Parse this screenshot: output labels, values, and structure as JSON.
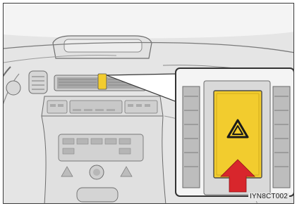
{
  "illustration": {
    "code": "IYN8CT002",
    "icons": {
      "hazard_switch": "hazard-warning-triangle-icon",
      "press_indicator": "red-arrow-up-icon"
    },
    "colors": {
      "background": "#e7e7e7",
      "line_art": "#6e6e6e",
      "switch_face": "#f2cc2e",
      "arrow": "#d8262c",
      "callout_frame": "#333333"
    }
  }
}
